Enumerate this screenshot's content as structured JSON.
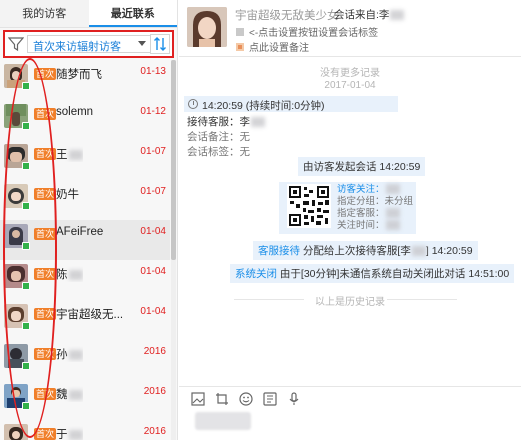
{
  "tabs": [
    {
      "label": "我的访客",
      "active": false
    },
    {
      "label": "最近联系",
      "active": true
    }
  ],
  "filter": {
    "selected": "首次来访辐射访客"
  },
  "visitors": [
    {
      "tag": "首次",
      "name": "随梦而飞",
      "date": "01-13",
      "date_color": "#e02020",
      "highlight": false
    },
    {
      "tag": "首次",
      "name": "solemn",
      "date": "01-12",
      "date_color": "#e02020",
      "highlight": false
    },
    {
      "tag": "首次",
      "name": "王",
      "date": "01-07",
      "date_color": "#e02020",
      "highlight": false
    },
    {
      "tag": "首次",
      "name": "奶牛",
      "date": "01-07",
      "date_color": "#e02020",
      "highlight": false
    },
    {
      "tag": "首次",
      "name": "AFeiFree",
      "date": "01-04",
      "date_color": "#e02020",
      "highlight": true
    },
    {
      "tag": "首次",
      "name": "陈",
      "date": "01-04",
      "date_color": "#e02020",
      "highlight": false
    },
    {
      "tag": "首次",
      "name": "宇宙超级无...",
      "date": "01-04",
      "date_color": "#e02020",
      "highlight": false
    },
    {
      "tag": "首次",
      "name": "孙",
      "date": "2016",
      "date_color": "#e02020",
      "highlight": false
    },
    {
      "tag": "首次",
      "name": "魏",
      "date": "2016",
      "date_color": "#e02020",
      "highlight": false
    },
    {
      "tag": "首次",
      "name": "于",
      "date": "2016",
      "date_color": "#e02020",
      "highlight": false
    }
  ],
  "header": {
    "name": "宇宙超级无敌美少女",
    "from_label": "会话来自:李",
    "hint_line": "<-点击设置按钮设置会话标签",
    "remark_line": "点此设置备注"
  },
  "chat": {
    "no_more": "没有更多记录",
    "date": "2017-01-04",
    "session_time": "14:20:59 (持续时间:0分钟)",
    "agent": "接待客服：李",
    "remark": "会话备注：无",
    "label": "会话标签：无",
    "visitor_start": "由访客发起会话 14:20:59",
    "qr_info": {
      "l1_link": "访客关注：",
      "l2": "指定分组：未分组",
      "l3": "指定客服：",
      "l4": "关注时间："
    },
    "assign_link": "客服接待",
    "assign_text": "分配给上次接待客服[李",
    "assign_time": "14:20:59",
    "close_link": "系统关闭",
    "close_text": "由于[30分钟]未通信系统自动关闭此对话",
    "close_time": "14:51:00",
    "history_label": "以上是历史记录"
  },
  "colors": {
    "accent": "#1a8ee8",
    "date_red": "#e02020",
    "tag_orange": "#f07f2a",
    "highlight_red": "#e02020"
  }
}
